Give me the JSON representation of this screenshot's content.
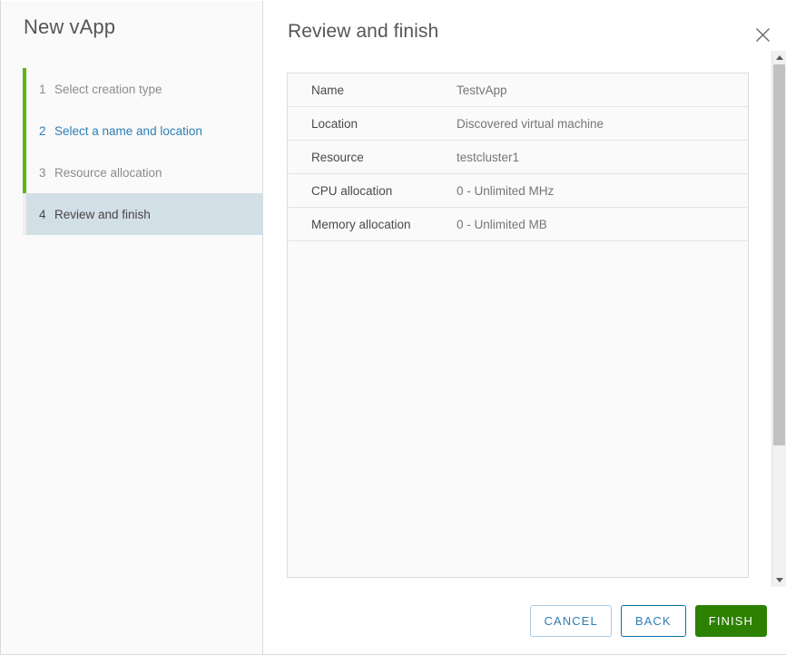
{
  "wizard": {
    "title": "New vApp",
    "steps": [
      {
        "num": "1",
        "label": "Select creation type",
        "state": "done"
      },
      {
        "num": "2",
        "label": "Select a name and location",
        "state": "link"
      },
      {
        "num": "3",
        "label": "Resource allocation",
        "state": "done"
      },
      {
        "num": "4",
        "label": "Review and finish",
        "state": "current"
      }
    ]
  },
  "panel": {
    "title": "Review and finish",
    "close_icon": "close-icon"
  },
  "summary": {
    "rows": [
      {
        "key": "Name",
        "value": "TestvApp"
      },
      {
        "key": "Location",
        "value": "Discovered virtual machine"
      },
      {
        "key": "Resource",
        "value": "testcluster1"
      },
      {
        "key": "CPU allocation",
        "value": "0 - Unlimited MHz"
      },
      {
        "key": "Memory allocation",
        "value": "0 - Unlimited MB"
      }
    ]
  },
  "scrollbar": {
    "up_icon": "triangle-up-icon",
    "down_icon": "triangle-down-icon"
  },
  "footer": {
    "cancel_label": "CANCEL",
    "back_label": "BACK",
    "finish_label": "FINISH"
  },
  "colors": {
    "accent_green": "#60b515",
    "finish_green": "#2c8100",
    "link_blue": "#2e7eb5",
    "selected_step": "#d3dfe6"
  }
}
